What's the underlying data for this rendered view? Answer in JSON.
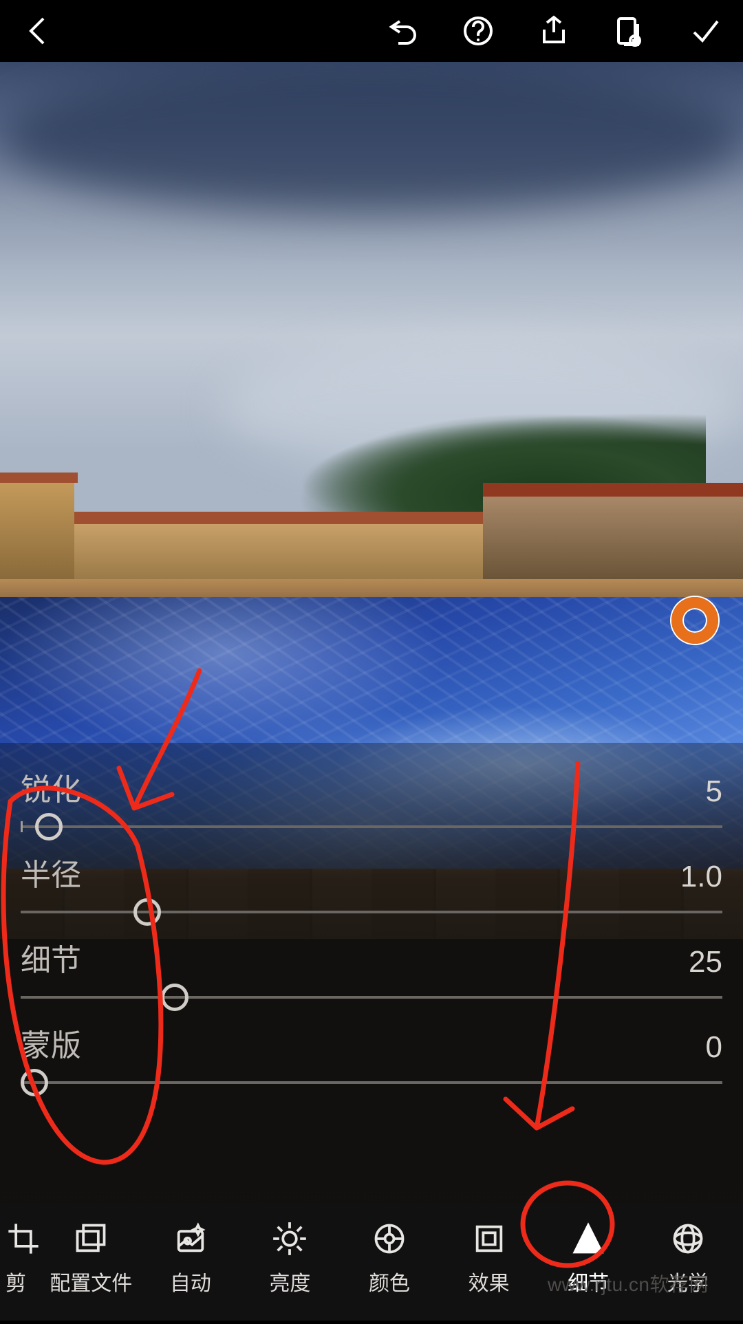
{
  "toolbar": {
    "back": "back",
    "undo": "undo",
    "help": "help",
    "share": "share",
    "presets": "presets",
    "confirm": "confirm"
  },
  "sliders": [
    {
      "label": "锐化",
      "value": "5",
      "pos": 0.04
    },
    {
      "label": "半径",
      "value": "1.0",
      "pos": 0.18
    },
    {
      "label": "细节",
      "value": "25",
      "pos": 0.22
    },
    {
      "label": "蒙版",
      "value": "0",
      "pos": 0.02
    }
  ],
  "tools": [
    {
      "label": "剪",
      "icon": "crop",
      "active": false,
      "partial": true
    },
    {
      "label": "配置文件",
      "icon": "profiles",
      "active": false
    },
    {
      "label": "自动",
      "icon": "auto",
      "active": false
    },
    {
      "label": "亮度",
      "icon": "light",
      "active": false
    },
    {
      "label": "颜色",
      "icon": "color",
      "active": false
    },
    {
      "label": "效果",
      "icon": "effects",
      "active": false
    },
    {
      "label": "细节",
      "icon": "detail",
      "active": true
    },
    {
      "label": "光学",
      "icon": "optics",
      "active": false
    }
  ],
  "watermark": "www.rjtu.cn软荐网"
}
